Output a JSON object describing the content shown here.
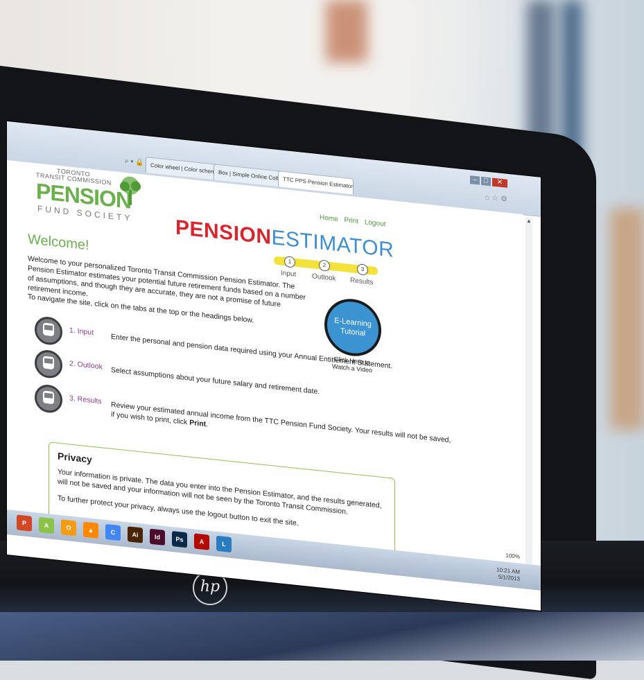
{
  "browser": {
    "tabs": [
      {
        "label": "Color wheel | Color schemes - Ad..."
      },
      {
        "label": "Box | Simple Online Collaboration..."
      },
      {
        "label": "TTC PPS Pension Estimator"
      }
    ],
    "zoom": "100%",
    "clock_time": "10:21 AM",
    "clock_date": "5/1/2013"
  },
  "logo": {
    "line1": "TORONTO",
    "line2": "TRANSIT COMMISSION",
    "main": "PENSION",
    "sub": "FUND SOCIETY"
  },
  "toplinks": {
    "home": "Home",
    "print": "Print",
    "logout": "Logout"
  },
  "title": {
    "part1": "PENSION",
    "part2": "ESTIMATOR"
  },
  "steps": [
    {
      "num": "1",
      "label": "Input"
    },
    {
      "num": "2",
      "label": "Outlook"
    },
    {
      "num": "3",
      "label": "Results"
    }
  ],
  "welcome": {
    "heading": "Welcome!",
    "intro": "Welcome to your personalized Toronto Transit Commission Pension Estimator. The Pension Estimator estimates your potential future retirement funds based on a number of assumptions, and though they are accurate, they are not a promise of future retirement income.",
    "nav_hint": "To navigate the site, click on the tabs at the top or the headings below."
  },
  "elearning": {
    "label": "E-Learning Tutorial",
    "caption": "Click Here to Watch a Video"
  },
  "sections": [
    {
      "link": "1. Input",
      "desc": "Enter the personal and pension data required using your Annual Entitlement Statement."
    },
    {
      "link": "2. Outlook",
      "desc": "Select assumptions about your future salary and retirement date."
    },
    {
      "link": "3. Results",
      "desc": "Review your estimated annual income from the TTC Pension Fund Society. Your results will not be saved,",
      "desc2_pre": "if you wish to print, click ",
      "desc2_bold": "Print",
      "desc2_post": "."
    }
  ],
  "privacy": {
    "heading": "Privacy",
    "p1": "Your information is private. The data you enter into the Pension Estimator, and the results generated, will not be saved and your information will not be seen by the Toronto Transit Commission.",
    "p2": "To further protect your privacy, always use the logout button to exit the site."
  },
  "taskbar_icons": [
    {
      "name": "powerpoint-icon",
      "text": "P",
      "color": "#d24726"
    },
    {
      "name": "android-icon",
      "text": "A",
      "color": "#8bc34a"
    },
    {
      "name": "media-icon",
      "text": "O",
      "color": "#f39c12"
    },
    {
      "name": "vlc-icon",
      "text": "▲",
      "color": "#ff8800"
    },
    {
      "name": "chrome-icon",
      "text": "C",
      "color": "#4285f4"
    },
    {
      "name": "illustrator-icon",
      "text": "Ai",
      "color": "#4a2300"
    },
    {
      "name": "indesign-icon",
      "text": "Id",
      "color": "#4b0d2b"
    },
    {
      "name": "photoshop-icon",
      "text": "Ps",
      "color": "#0b2a4a"
    },
    {
      "name": "acrobat-icon",
      "text": "A",
      "color": "#b30b00"
    },
    {
      "name": "lync-icon",
      "text": "L",
      "color": "#2a7bc0"
    }
  ],
  "laptop_brand": "hp"
}
